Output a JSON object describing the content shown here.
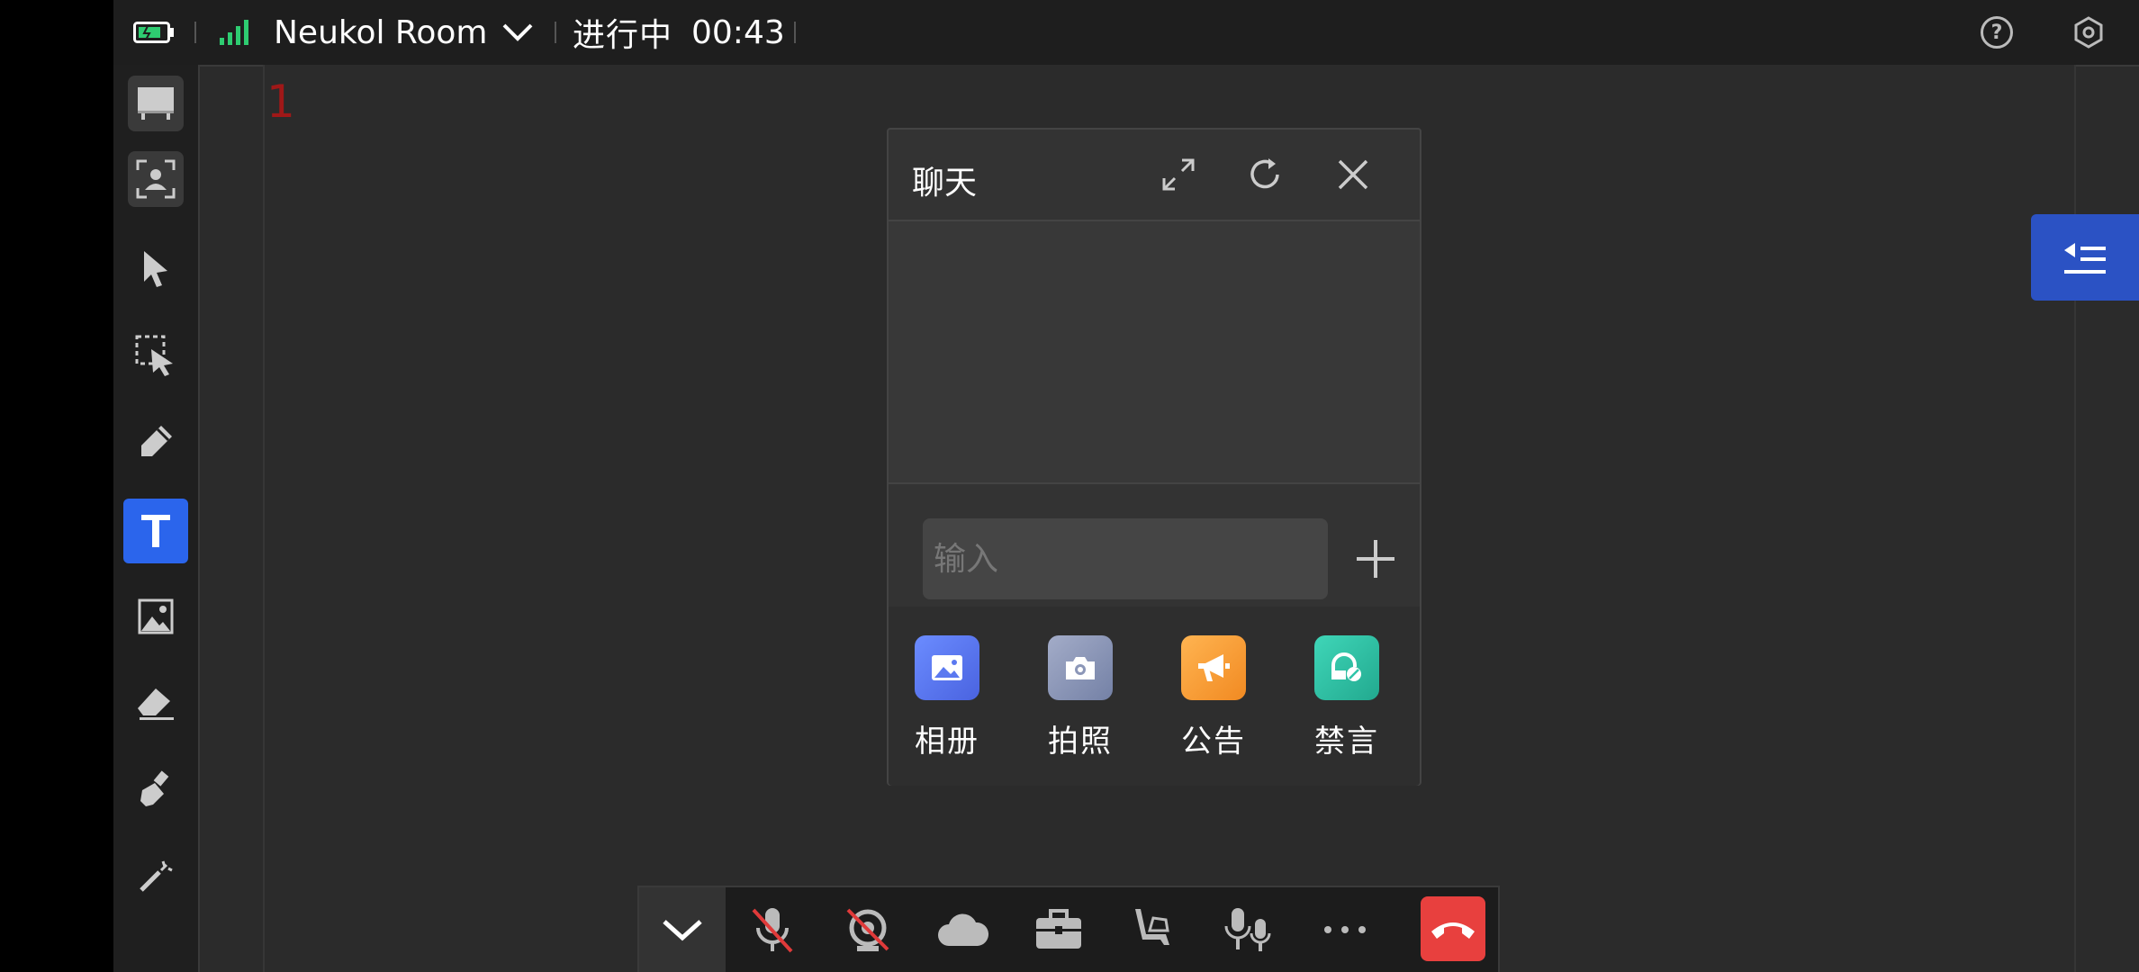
{
  "colors": {
    "accent": "#2b65ec",
    "drawer_tab": "#2b52c4",
    "hangup": "#e8403e",
    "signal": "#2ecc71",
    "page_number": "#a01818"
  },
  "topbar": {
    "room_name": "Neukol Room",
    "status": "进行中",
    "timer": "00:43",
    "icons": [
      "battery-icon",
      "signal-icon",
      "chevron-down-icon",
      "help-icon",
      "settings-icon"
    ]
  },
  "toolbar": {
    "items": [
      "whiteboard-icon",
      "user-frame-icon",
      "pointer-icon",
      "select-icon",
      "pen-icon",
      "text-icon",
      "image-icon",
      "eraser-icon",
      "clear-icon",
      "laser-icon"
    ],
    "active": "text-icon"
  },
  "canvas": {
    "page_number": "1"
  },
  "chat": {
    "title": "聊天",
    "input_placeholder": "输入",
    "actions": [
      {
        "label": "相册",
        "icon": "album-icon",
        "color": "#5b79f0"
      },
      {
        "label": "拍照",
        "icon": "camera-icon",
        "color": "#8c97b8"
      },
      {
        "label": "公告",
        "icon": "announcement-icon",
        "color": "#f6a23a"
      },
      {
        "label": "禁言",
        "icon": "mute-chat-icon",
        "color": "#2ec4a8"
      }
    ]
  },
  "bottombar": {
    "icons": [
      "collapse-icon",
      "mic-off-icon",
      "camera-off-icon",
      "cloud-icon",
      "briefcase-icon",
      "seat-icon",
      "microphones-icon",
      "more-icon",
      "hangup-icon"
    ]
  }
}
